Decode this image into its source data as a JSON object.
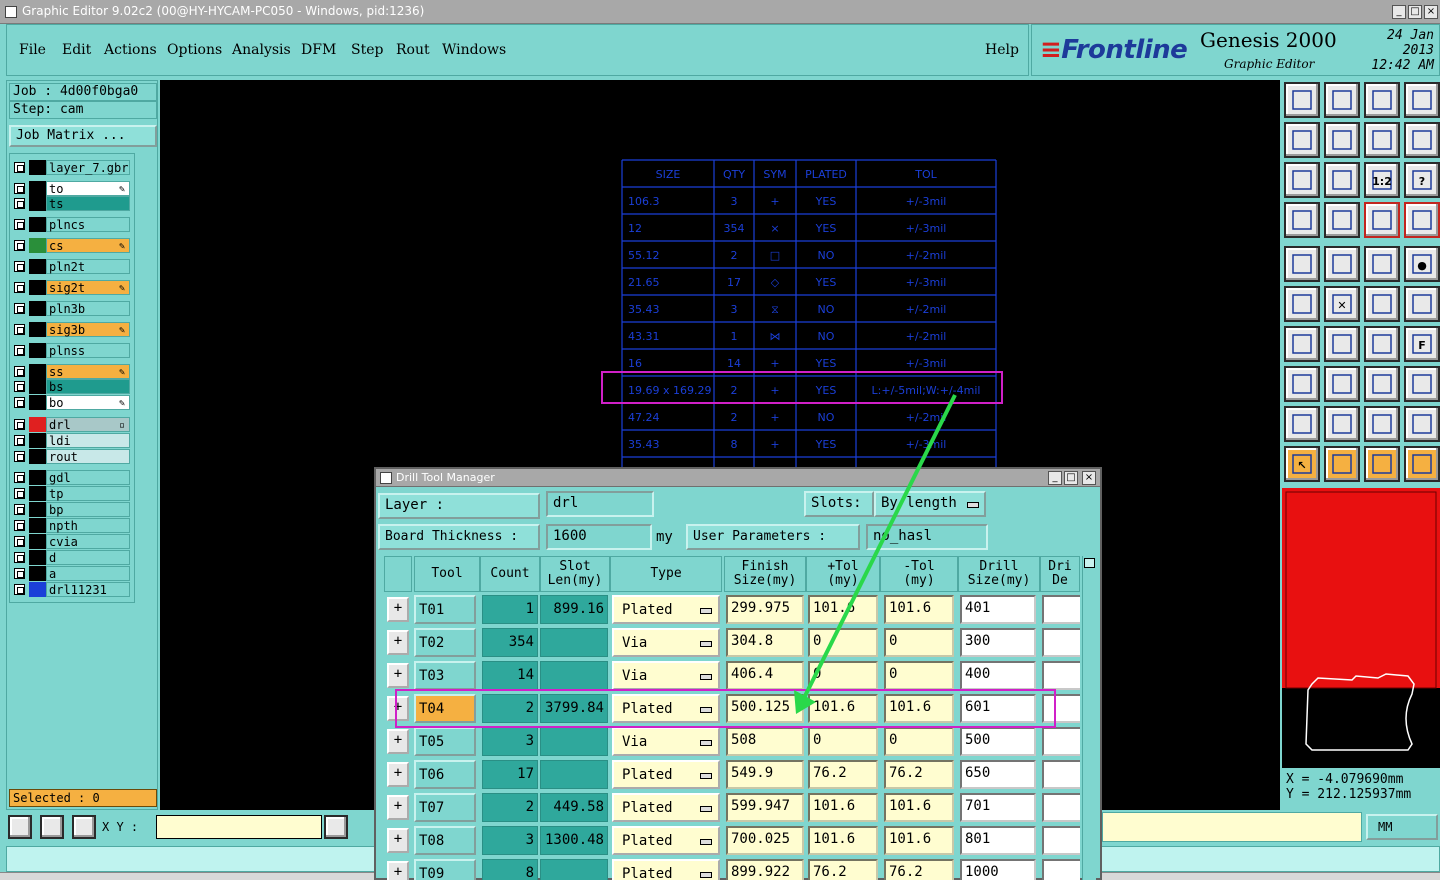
{
  "window": {
    "title": "Graphic Editor 9.02c2 (00@HY-HYCAM-PC050 - Windows, pid:1236)",
    "minimize": "_",
    "maximize": "□",
    "close": "×"
  },
  "menu": [
    "File",
    "Edit",
    "Actions",
    "Options",
    "Analysis",
    "DFM",
    "Step",
    "Rout",
    "Windows"
  ],
  "help": "Help",
  "brand": {
    "logo": "Frontline",
    "product": "Genesis 2000",
    "subtitle": "Graphic Editor",
    "date": "24 Jan 2013",
    "time": "12:42 AM"
  },
  "job": {
    "job_line": "Job : 4d00f0bga0",
    "step_line": "Step: cam",
    "matrix_button": "Job Matrix ..."
  },
  "layers": [
    {
      "name": "layer_7.gbr",
      "bg": "#7fd6cf",
      "swatch": "#000000",
      "mark": ""
    },
    {
      "name": "to",
      "bg": "#ffffff",
      "swatch": "#000000",
      "mark": "✎"
    },
    {
      "name": "ts",
      "bg": "#1f9b8e",
      "swatch": "#000000",
      "mark": ""
    },
    {
      "name": "plncs",
      "bg": "#7fd6cf",
      "swatch": "#000000",
      "mark": ""
    },
    {
      "name": "cs",
      "bg": "#f5b041",
      "swatch": "#2a8f3a",
      "mark": "✎"
    },
    {
      "name": "pln2t",
      "bg": "#7fd6cf",
      "swatch": "#000000",
      "mark": ""
    },
    {
      "name": "sig2t",
      "bg": "#f5b041",
      "swatch": "#000000",
      "mark": "✎"
    },
    {
      "name": "pln3b",
      "bg": "#7fd6cf",
      "swatch": "#000000",
      "mark": ""
    },
    {
      "name": "sig3b",
      "bg": "#f5b041",
      "swatch": "#000000",
      "mark": "✎"
    },
    {
      "name": "plnss",
      "bg": "#7fd6cf",
      "swatch": "#000000",
      "mark": ""
    },
    {
      "name": "ss",
      "bg": "#f5b041",
      "swatch": "#000000",
      "mark": "✎"
    },
    {
      "name": "bs",
      "bg": "#1f9b8e",
      "swatch": "#000000",
      "mark": ""
    },
    {
      "name": "bo",
      "bg": "#ffffff",
      "swatch": "#000000",
      "mark": "✎"
    },
    {
      "name": "drl",
      "bg": "#a8c8c8",
      "swatch": "#e02020",
      "mark": "▫"
    },
    {
      "name": "ldi",
      "bg": "#c8e8e8",
      "swatch": "#000000",
      "mark": ""
    },
    {
      "name": "rout",
      "bg": "#c8e8e8",
      "swatch": "#000000",
      "mark": ""
    },
    {
      "name": "gdl",
      "bg": "#7fd6cf",
      "swatch": "#000000",
      "mark": ""
    },
    {
      "name": "tp",
      "bg": "#7fd6cf",
      "swatch": "#000000",
      "mark": ""
    },
    {
      "name": "bp",
      "bg": "#7fd6cf",
      "swatch": "#000000",
      "mark": ""
    },
    {
      "name": "npth",
      "bg": "#7fd6cf",
      "swatch": "#000000",
      "mark": ""
    },
    {
      "name": "cvia",
      "bg": "#7fd6cf",
      "swatch": "#000000",
      "mark": ""
    },
    {
      "name": "d",
      "bg": "#7fd6cf",
      "swatch": "#000000",
      "mark": ""
    },
    {
      "name": "a",
      "bg": "#7fd6cf",
      "swatch": "#000000",
      "mark": ""
    },
    {
      "name": "drl11231",
      "bg": "#7fd6cf",
      "swatch": "#1b3fd8",
      "mark": ""
    }
  ],
  "selected": "Selected : 0",
  "xy_label": "X Y :",
  "xy_value": "",
  "coords": {
    "x": "X  = -4.079690mm",
    "y": "Y  = 212.125937mm"
  },
  "units": "MM",
  "drawing_table": {
    "headers": [
      "SIZE",
      "QTY",
      "SYM",
      "PLATED",
      "TOL"
    ],
    "rows": [
      [
        "106.3",
        "3",
        "+",
        "YES",
        "+/-3mil"
      ],
      [
        "12",
        "354",
        "×",
        "YES",
        "+/-3mil"
      ],
      [
        "55.12",
        "2",
        "□",
        "NO",
        "+/-2mil"
      ],
      [
        "21.65",
        "17",
        "◇",
        "YES",
        "+/-3mil"
      ],
      [
        "35.43",
        "3",
        "⧖",
        "NO",
        "+/-2mil"
      ],
      [
        "43.31",
        "1",
        "⋈",
        "NO",
        "+/-2mil"
      ],
      [
        "16",
        "14",
        "+",
        "YES",
        "+/-3mil"
      ],
      [
        "19.69 x 169.29",
        "2",
        "+",
        "YES",
        "L:+/-5mil;W:+/-4mil"
      ],
      [
        "47.24",
        "2",
        "+",
        "NO",
        "+/-2mil"
      ],
      [
        "35.43",
        "8",
        "+",
        "YES",
        "+/-3mil"
      ]
    ]
  },
  "dtm": {
    "title": "Drill Tool Manager",
    "layer_label": "Layer        :",
    "layer_value": "drl",
    "slots_label": "Slots:",
    "slots_value": "By length",
    "thickness_label": "Board Thickness :",
    "thickness_value": "1600",
    "thickness_unit": "my",
    "user_params_label": "User Parameters :",
    "user_params_value": "no_hasl",
    "headers": {
      "tool": "Tool",
      "count": "Count",
      "slot_len": [
        "Slot",
        "Len(my)"
      ],
      "type": "Type",
      "finish": [
        "Finish",
        "Size(my)"
      ],
      "ptol": [
        "+Tol",
        "(my)"
      ],
      "mtol": [
        "-Tol",
        "(my)"
      ],
      "drill": [
        "Drill",
        "Size(my)"
      ],
      "drill_des": [
        "Dri",
        "De"
      ]
    },
    "rows": [
      {
        "tool": "T01",
        "count": "1",
        "slot": "899.16",
        "type": "Plated",
        "finish": "299.975",
        "ptol": "101.6",
        "mtol": "101.6",
        "drill": "401"
      },
      {
        "tool": "T02",
        "count": "354",
        "slot": "",
        "type": "Via",
        "finish": "304.8",
        "ptol": "0",
        "mtol": "0",
        "drill": "300"
      },
      {
        "tool": "T03",
        "count": "14",
        "slot": "",
        "type": "Via",
        "finish": "406.4",
        "ptol": "0",
        "mtol": "0",
        "drill": "400"
      },
      {
        "tool": "T04",
        "count": "2",
        "slot": "3799.84",
        "type": "Plated",
        "finish": "500.125",
        "ptol": "101.6",
        "mtol": "101.6",
        "drill": "601"
      },
      {
        "tool": "T05",
        "count": "3",
        "slot": "",
        "type": "Via",
        "finish": "508",
        "ptol": "0",
        "mtol": "0",
        "drill": "500"
      },
      {
        "tool": "T06",
        "count": "17",
        "slot": "",
        "type": "Plated",
        "finish": "549.9",
        "ptol": "76.2",
        "mtol": "76.2",
        "drill": "650"
      },
      {
        "tool": "T07",
        "count": "2",
        "slot": "449.58",
        "type": "Plated",
        "finish": "599.947",
        "ptol": "101.6",
        "mtol": "101.6",
        "drill": "701"
      },
      {
        "tool": "T08",
        "count": "3",
        "slot": "1300.48",
        "type": "Plated",
        "finish": "700.025",
        "ptol": "101.6",
        "mtol": "101.6",
        "drill": "801"
      },
      {
        "tool": "T09",
        "count": "8",
        "slot": "",
        "type": "Plated",
        "finish": "899.922",
        "ptol": "76.2",
        "mtol": "76.2",
        "drill": "1000"
      }
    ]
  },
  "colors": {
    "canvas": "#000000",
    "blue_lines": "#1b3fd8",
    "highlight": "#d020c8",
    "arrow": "#2ad84a",
    "panel": "#7fd6cf"
  }
}
